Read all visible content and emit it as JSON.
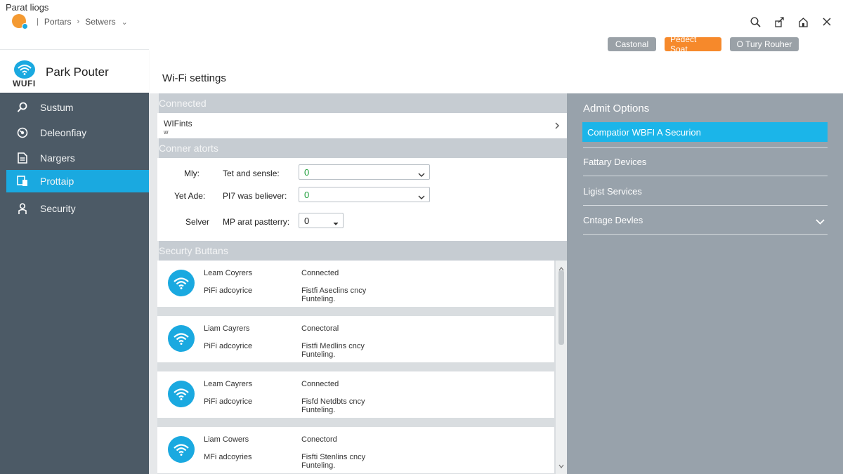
{
  "window": {
    "title": "Parat liogs",
    "breadcrumb": [
      "Portars",
      "Setwers"
    ],
    "icons": [
      "search-icon",
      "share-icon",
      "home-icon",
      "close-icon"
    ]
  },
  "toolbar": {
    "buttons": [
      "Castonal",
      "Pedect Soat",
      "O Tury Rouher"
    ]
  },
  "sidebar": {
    "logo_label": "WUFI",
    "router_name": "Park Pouter",
    "items": [
      {
        "label": "Sustum",
        "icon": "search-icon"
      },
      {
        "label": "Deleonfiay",
        "icon": "dashboard-icon"
      },
      {
        "label": "Nargers",
        "icon": "document-icon"
      },
      {
        "label": "Prottaip",
        "icon": "device-icon",
        "active": true
      },
      {
        "label": "Security",
        "icon": "user-icon"
      }
    ]
  },
  "main": {
    "title": "Wi-Fi settings",
    "sections": [
      "Connected",
      "Conner atorts",
      "Securty Buttans"
    ],
    "connected_row": {
      "text": "WIFints",
      "sub": "w"
    },
    "fields": [
      {
        "label": "Mly:",
        "sublabel": "Tet and sensle:",
        "value": "0"
      },
      {
        "label": "Yet Ade:",
        "sublabel": "PI7 was believer:",
        "value": "0"
      },
      {
        "label": "Selver",
        "sublabel": "MP arat pastterry:",
        "value": "0"
      }
    ],
    "cards": [
      {
        "title": "Leam Coyrers",
        "subtitle": "PiFi adcoyrice",
        "status": "Connected",
        "detail": "Fistfi Aseclins cncy Funteling."
      },
      {
        "title": "Liam Cayrers",
        "subtitle": "PiFi adcoyrice",
        "status": "Conectoral",
        "detail": "Fistfi Medlins cncy Funteling."
      },
      {
        "title": "Leam Cayrers",
        "subtitle": "PiFi adcoyrice",
        "status": "Connected",
        "detail": "Fisfd Netdbts cncy Funteling."
      },
      {
        "title": "Liam Cowers",
        "subtitle": "MFi adcoyries",
        "status": "Conectord",
        "detail": "Fisfti Stenlins cncy Funteling."
      }
    ]
  },
  "admin": {
    "title": "Admit Options",
    "items": [
      "Compatior WBFI A Securion",
      "Fattary Devices",
      "Ligist Services",
      "Cntage Devles"
    ]
  },
  "colors": {
    "accent": "#1aa9e0",
    "orange": "#f6892b",
    "sidebar": "#4c5a66",
    "right_panel": "#98a2ab",
    "green_value": "#1e9e3a"
  }
}
